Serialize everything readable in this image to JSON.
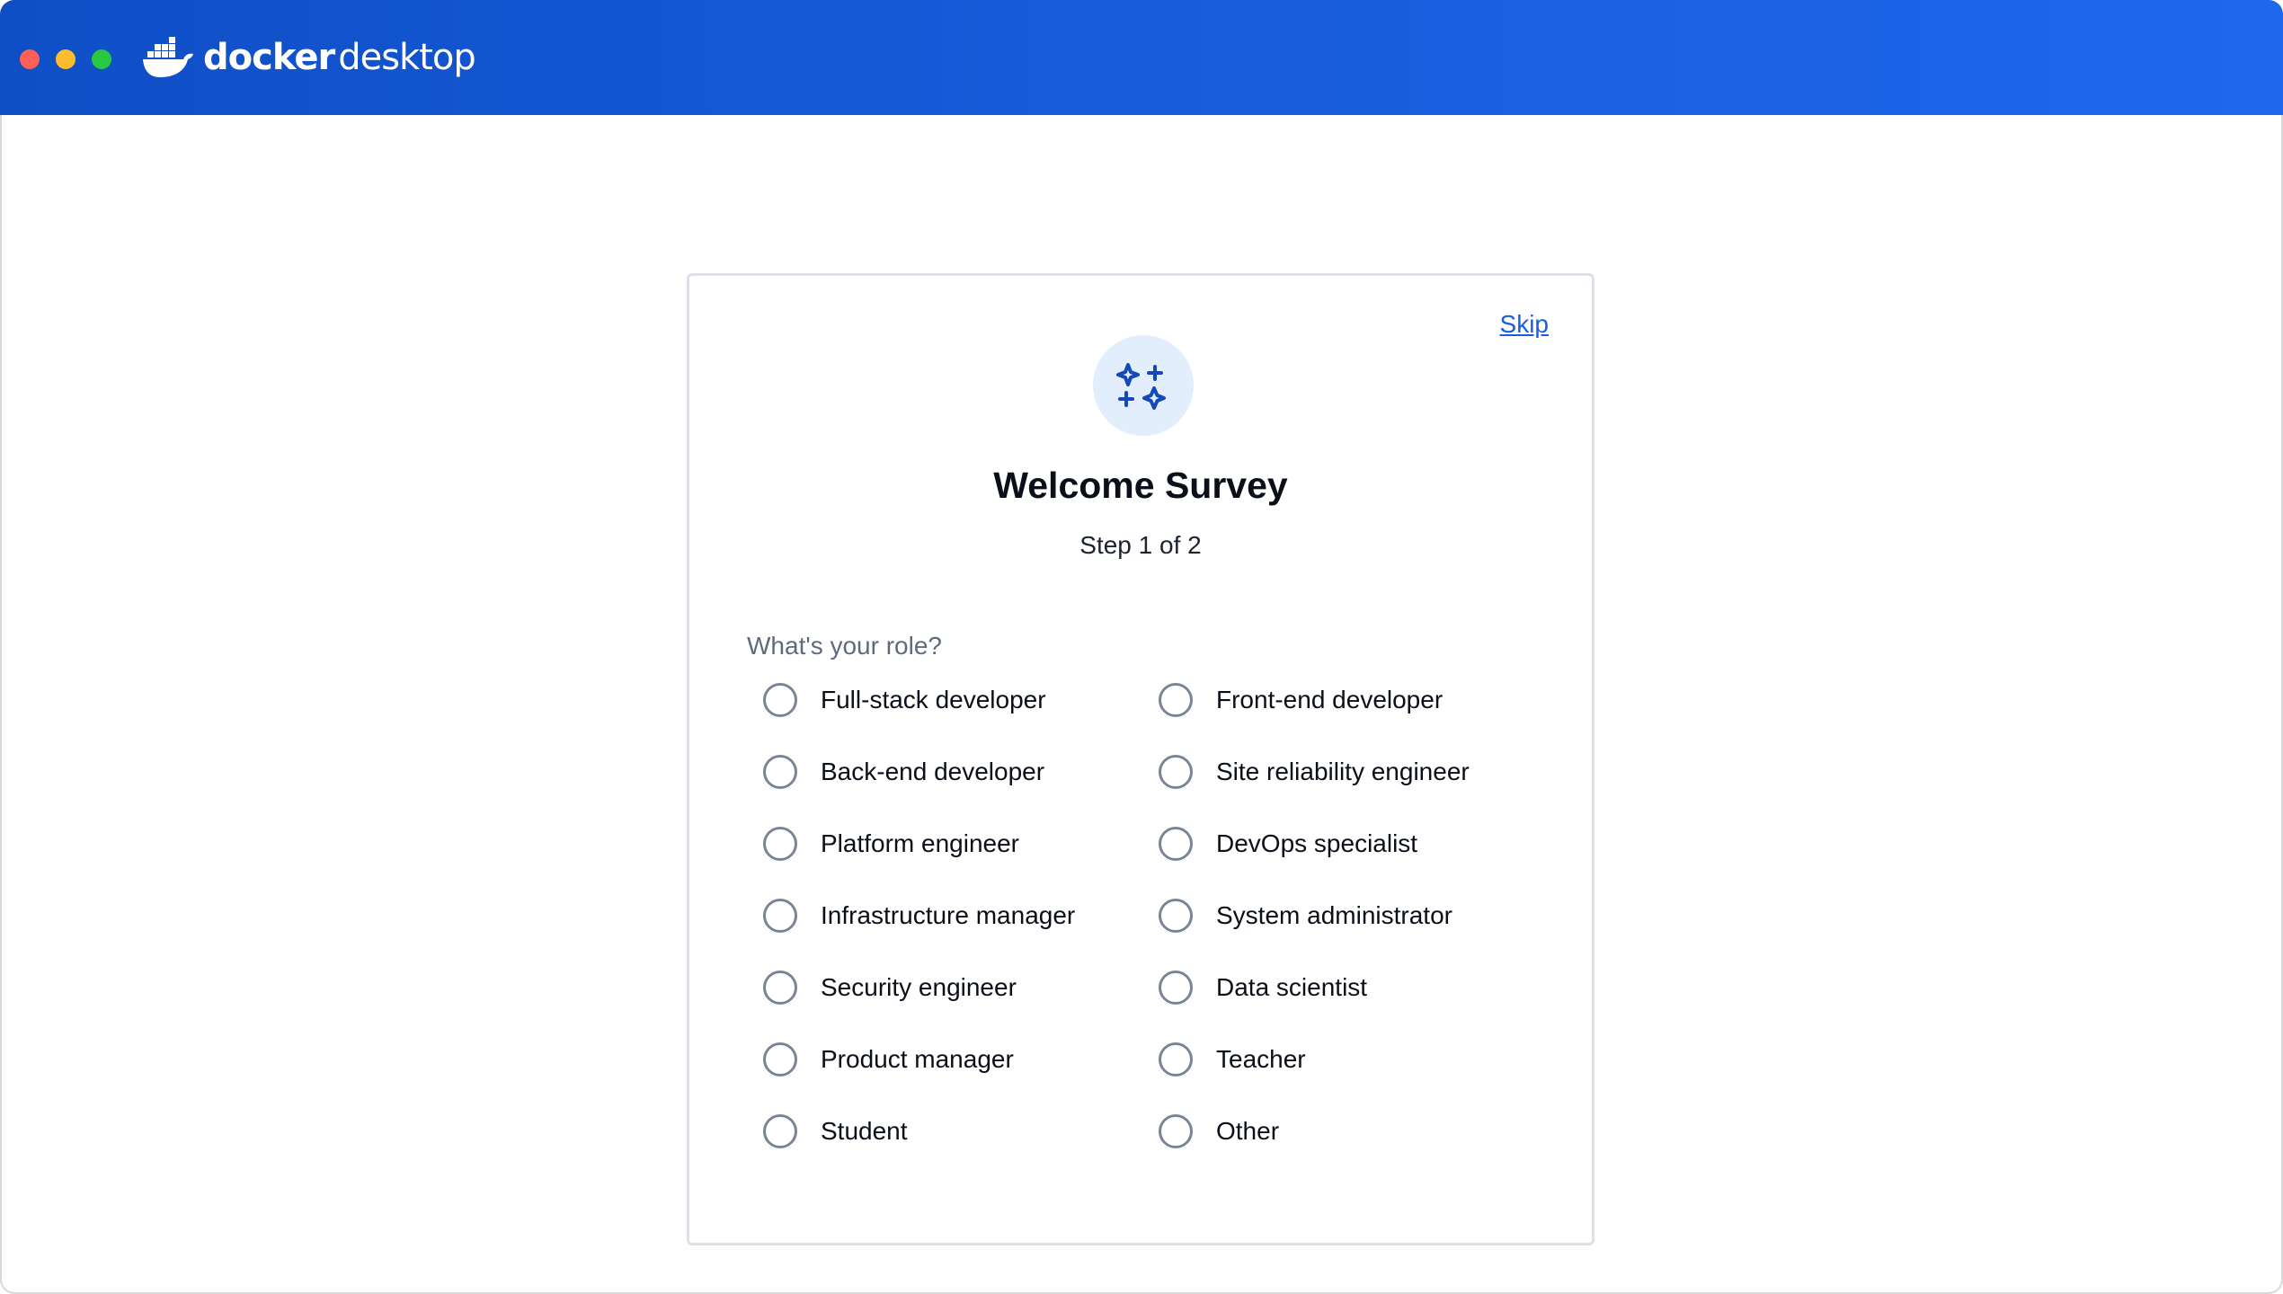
{
  "app": {
    "logo_word_docker": "docker",
    "logo_word_desktop": "desktop",
    "logo_icon": "docker-whale-icon",
    "titlebar_color": "#1a5ee0"
  },
  "survey": {
    "skip_label": "Skip",
    "badge_icon": "sparkles-icon",
    "title": "Welcome Survey",
    "step": "Step 1 of 2",
    "question": "What's your role?",
    "options": [
      {
        "label": "Full-stack developer",
        "selected": false
      },
      {
        "label": "Front-end developer",
        "selected": false
      },
      {
        "label": "Back-end developer",
        "selected": false
      },
      {
        "label": "Site reliability engineer",
        "selected": false
      },
      {
        "label": "Platform engineer",
        "selected": false
      },
      {
        "label": "DevOps specialist",
        "selected": false
      },
      {
        "label": "Infrastructure manager",
        "selected": false
      },
      {
        "label": "System administrator",
        "selected": false
      },
      {
        "label": "Security engineer",
        "selected": false
      },
      {
        "label": "Data scientist",
        "selected": false
      },
      {
        "label": "Product manager",
        "selected": false
      },
      {
        "label": "Teacher",
        "selected": false
      },
      {
        "label": "Student",
        "selected": false
      },
      {
        "label": "Other",
        "selected": false
      }
    ]
  },
  "colors": {
    "accent": "#1a5ee0",
    "radio_border": "#7a8599",
    "badge_bg": "#e3eefc",
    "sparkle": "#1549b8"
  }
}
